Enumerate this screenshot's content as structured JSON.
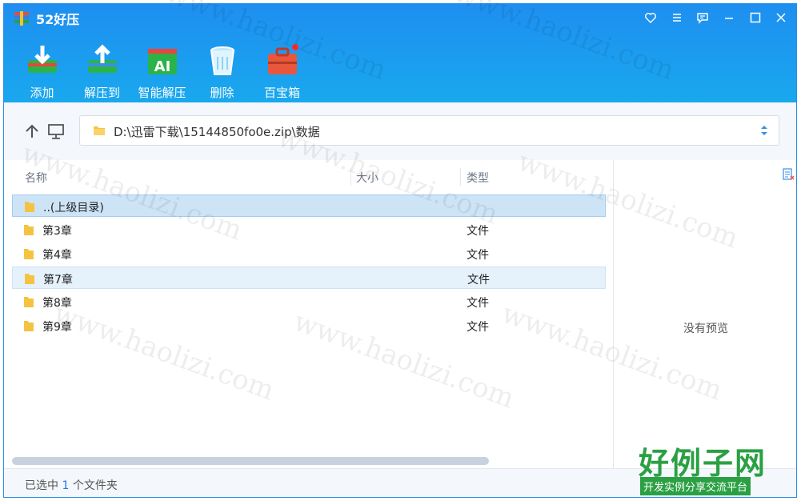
{
  "app": {
    "title": "52好压",
    "accent": "#1e8ff0"
  },
  "window_controls": [
    {
      "name": "favorite-icon"
    },
    {
      "name": "menu-icon"
    },
    {
      "name": "feedback-icon"
    },
    {
      "name": "minimize-icon"
    },
    {
      "name": "maximize-icon"
    },
    {
      "name": "close-icon"
    }
  ],
  "toolbar": {
    "add": "添加",
    "extract_to": "解压到",
    "smart_extract": "智能解压",
    "delete": "删除",
    "toolbox": "百宝箱"
  },
  "address": {
    "path": "D:\\迅雷下载\\15144850fo0e.zip\\数据"
  },
  "columns": {
    "name": "名称",
    "size": "大小",
    "type": "类型"
  },
  "rows": [
    {
      "name": "..(上级目录)",
      "type": ""
    },
    {
      "name": "第3章",
      "type": "文件"
    },
    {
      "name": "第4章",
      "type": "文件"
    },
    {
      "name": "第7章",
      "type": "文件"
    },
    {
      "name": "第8章",
      "type": "文件"
    },
    {
      "name": "第9章",
      "type": "文件"
    }
  ],
  "preview": {
    "empty_text": "没有预览"
  },
  "status": {
    "prefix": "已选中",
    "count": "1",
    "suffix": "个文件夹"
  },
  "watermark": {
    "text": "www.haolizi.com"
  },
  "brand": {
    "title": "好例子网",
    "subtitle": "开发实例分享交流平台"
  }
}
